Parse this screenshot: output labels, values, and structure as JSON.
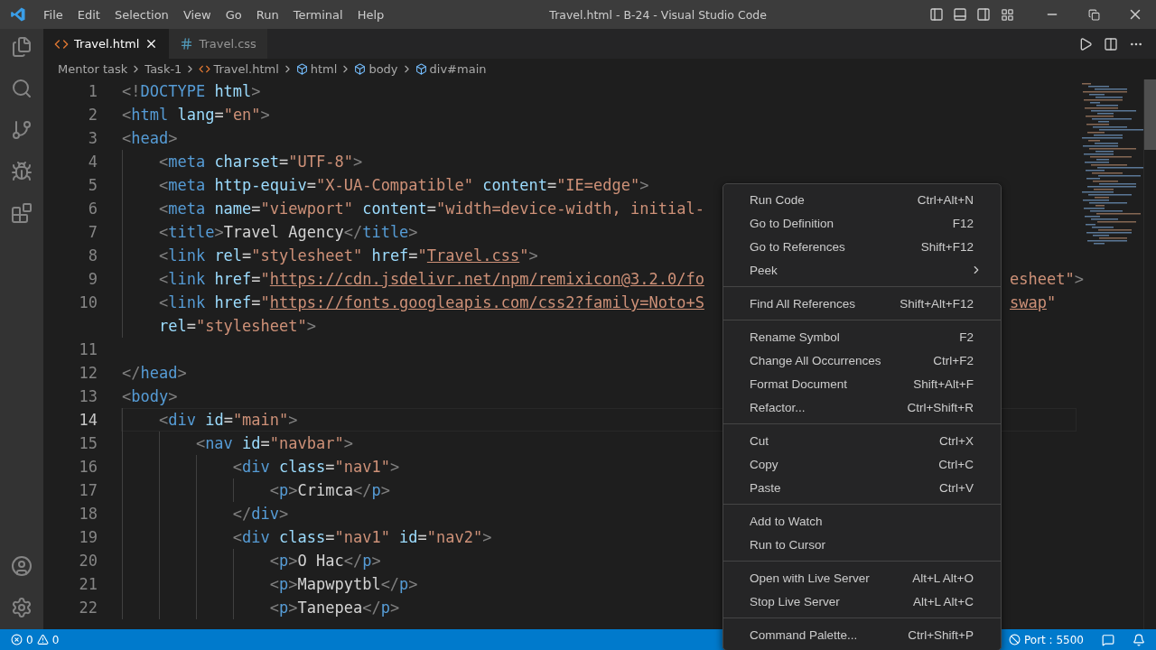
{
  "window": {
    "title": "Travel.html - B-24 - Visual Studio Code"
  },
  "menu_bar": [
    "File",
    "Edit",
    "Selection",
    "View",
    "Go",
    "Run",
    "Terminal",
    "Help"
  ],
  "tabs": [
    {
      "label": "Travel.html",
      "kind": "html",
      "selected": true
    },
    {
      "label": "Travel.css",
      "kind": "css",
      "selected": false
    }
  ],
  "breadcrumbs": [
    {
      "label": "Mentor task",
      "kind": "folder"
    },
    {
      "label": "Task-1",
      "kind": "folder"
    },
    {
      "label": "Travel.html",
      "kind": "file"
    },
    {
      "label": "html",
      "kind": "symbol"
    },
    {
      "label": "body",
      "kind": "symbol"
    },
    {
      "label": "div#main",
      "kind": "symbol"
    }
  ],
  "code_lines": [
    {
      "number": "1",
      "active": false,
      "tokens": [
        {
          "kind": "p",
          "text": "<!"
        },
        {
          "kind": "tag",
          "text": "DOCTYPE"
        },
        {
          "kind": "attr",
          "text": " html"
        },
        {
          "kind": "p",
          "text": ">"
        }
      ]
    },
    {
      "number": "2",
      "active": false,
      "tokens": [
        {
          "kind": "p",
          "text": "<"
        },
        {
          "kind": "tag",
          "text": "html"
        },
        {
          "kind": "attr",
          "text": " lang"
        },
        {
          "kind": "eq",
          "text": "="
        },
        {
          "kind": "str",
          "text": "\"en\""
        },
        {
          "kind": "p",
          "text": ">"
        }
      ]
    },
    {
      "number": "3",
      "active": false,
      "tokens": [
        {
          "kind": "p",
          "text": "<"
        },
        {
          "kind": "tag",
          "text": "head"
        },
        {
          "kind": "p",
          "text": ">"
        }
      ]
    },
    {
      "number": "4",
      "active": false,
      "tokens": [
        {
          "kind": "p",
          "text": "    <"
        },
        {
          "kind": "tag",
          "text": "meta"
        },
        {
          "kind": "attr",
          "text": " charset"
        },
        {
          "kind": "eq",
          "text": "="
        },
        {
          "kind": "str",
          "text": "\"UTF-8\""
        },
        {
          "kind": "p",
          "text": ">"
        }
      ]
    },
    {
      "number": "5",
      "active": false,
      "tokens": [
        {
          "kind": "p",
          "text": "    <"
        },
        {
          "kind": "tag",
          "text": "meta"
        },
        {
          "kind": "attr",
          "text": " http-equiv"
        },
        {
          "kind": "eq",
          "text": "="
        },
        {
          "kind": "str",
          "text": "\"X-UA-Compatible\""
        },
        {
          "kind": "attr",
          "text": " content"
        },
        {
          "kind": "eq",
          "text": "="
        },
        {
          "kind": "str",
          "text": "\"IE=edge\""
        },
        {
          "kind": "p",
          "text": ">"
        }
      ]
    },
    {
      "number": "6",
      "active": false,
      "tokens": [
        {
          "kind": "p",
          "text": "    <"
        },
        {
          "kind": "tag",
          "text": "meta"
        },
        {
          "kind": "attr",
          "text": " name"
        },
        {
          "kind": "eq",
          "text": "="
        },
        {
          "kind": "str",
          "text": "\"viewport\""
        },
        {
          "kind": "attr",
          "text": " content"
        },
        {
          "kind": "eq",
          "text": "="
        },
        {
          "kind": "str",
          "text": "\"width=device-width, initial-"
        }
      ]
    },
    {
      "number": "7",
      "active": false,
      "tokens": [
        {
          "kind": "p",
          "text": "    <"
        },
        {
          "kind": "tag",
          "text": "title"
        },
        {
          "kind": "p",
          "text": ">"
        },
        {
          "kind": "text",
          "text": "Travel Agency"
        },
        {
          "kind": "p",
          "text": "</"
        },
        {
          "kind": "tag",
          "text": "title"
        },
        {
          "kind": "p",
          "text": ">"
        }
      ]
    },
    {
      "number": "8",
      "active": false,
      "tokens": [
        {
          "kind": "p",
          "text": "    <"
        },
        {
          "kind": "tag",
          "text": "link"
        },
        {
          "kind": "attr",
          "text": " rel"
        },
        {
          "kind": "eq",
          "text": "="
        },
        {
          "kind": "str",
          "text": "\"stylesheet\""
        },
        {
          "kind": "attr",
          "text": " href"
        },
        {
          "kind": "eq",
          "text": "="
        },
        {
          "kind": "str",
          "text": "\""
        },
        {
          "kind": "link",
          "text": "Travel.css"
        },
        {
          "kind": "str",
          "text": "\""
        },
        {
          "kind": "p",
          "text": ">"
        }
      ]
    },
    {
      "number": "9",
      "active": false,
      "tokens": [
        {
          "kind": "p",
          "text": "    <"
        },
        {
          "kind": "tag",
          "text": "link"
        },
        {
          "kind": "attr",
          "text": " href"
        },
        {
          "kind": "eq",
          "text": "="
        },
        {
          "kind": "str",
          "text": "\""
        },
        {
          "kind": "link",
          "text": "https://cdn.jsdelivr.net/npm/remixicon@3.2.0/fo"
        }
      ],
      "tail": [
        {
          "kind": "str",
          "text": "esheet\""
        },
        {
          "kind": "p",
          "text": ">"
        }
      ]
    },
    {
      "number": "10",
      "active": false,
      "tokens": [
        {
          "kind": "p",
          "text": "    <"
        },
        {
          "kind": "tag",
          "text": "link"
        },
        {
          "kind": "attr",
          "text": " href"
        },
        {
          "kind": "eq",
          "text": "="
        },
        {
          "kind": "str",
          "text": "\""
        },
        {
          "kind": "link",
          "text": "https://fonts.googleapis.com/css2?family=Noto+S"
        }
      ],
      "tail": [
        {
          "kind": "link",
          "text": "swap"
        },
        {
          "kind": "str",
          "text": "\""
        }
      ],
      "wrap": [
        {
          "kind": "attr",
          "text": "    rel"
        },
        {
          "kind": "eq",
          "text": "="
        },
        {
          "kind": "str",
          "text": "\"stylesheet\""
        },
        {
          "kind": "p",
          "text": ">"
        }
      ]
    },
    {
      "number": "11",
      "active": false
    },
    {
      "number": "12",
      "active": false,
      "tokens": [
        {
          "kind": "p",
          "text": "</"
        },
        {
          "kind": "tag",
          "text": "head"
        },
        {
          "kind": "p",
          "text": ">"
        }
      ]
    },
    {
      "number": "13",
      "active": false,
      "tokens": [
        {
          "kind": "p",
          "text": "<"
        },
        {
          "kind": "tag",
          "text": "body"
        },
        {
          "kind": "p",
          "text": ">"
        }
      ]
    },
    {
      "number": "14",
      "active": true,
      "tokens": [
        {
          "kind": "p",
          "text": "    <"
        },
        {
          "kind": "tag",
          "text": "div"
        },
        {
          "kind": "attr",
          "text": " id"
        },
        {
          "kind": "eq",
          "text": "="
        },
        {
          "kind": "str",
          "text": "\"main\""
        },
        {
          "kind": "p",
          "text": ">"
        }
      ]
    },
    {
      "number": "15",
      "active": false,
      "tokens": [
        {
          "kind": "p",
          "text": "        <"
        },
        {
          "kind": "tag",
          "text": "nav"
        },
        {
          "kind": "attr",
          "text": " id"
        },
        {
          "kind": "eq",
          "text": "="
        },
        {
          "kind": "str",
          "text": "\"navbar\""
        },
        {
          "kind": "p",
          "text": ">"
        }
      ]
    },
    {
      "number": "16",
      "active": false,
      "tokens": [
        {
          "kind": "p",
          "text": "            <"
        },
        {
          "kind": "tag",
          "text": "div"
        },
        {
          "kind": "attr",
          "text": " class"
        },
        {
          "kind": "eq",
          "text": "="
        },
        {
          "kind": "str",
          "text": "\"nav1\""
        },
        {
          "kind": "p",
          "text": ">"
        }
      ]
    },
    {
      "number": "17",
      "active": false,
      "tokens": [
        {
          "kind": "p",
          "text": "                <"
        },
        {
          "kind": "tag",
          "text": "p"
        },
        {
          "kind": "p",
          "text": ">"
        },
        {
          "kind": "text",
          "text": "Crimca"
        },
        {
          "kind": "p",
          "text": "</"
        },
        {
          "kind": "tag",
          "text": "p"
        },
        {
          "kind": "p",
          "text": ">"
        }
      ]
    },
    {
      "number": "18",
      "active": false,
      "tokens": [
        {
          "kind": "p",
          "text": "            </"
        },
        {
          "kind": "tag",
          "text": "div"
        },
        {
          "kind": "p",
          "text": ">"
        }
      ]
    },
    {
      "number": "19",
      "active": false,
      "tokens": [
        {
          "kind": "p",
          "text": "            <"
        },
        {
          "kind": "tag",
          "text": "div"
        },
        {
          "kind": "attr",
          "text": " class"
        },
        {
          "kind": "eq",
          "text": "="
        },
        {
          "kind": "str",
          "text": "\"nav1\""
        },
        {
          "kind": "attr",
          "text": " id"
        },
        {
          "kind": "eq",
          "text": "="
        },
        {
          "kind": "str",
          "text": "\"nav2\""
        },
        {
          "kind": "p",
          "text": ">"
        }
      ]
    },
    {
      "number": "20",
      "active": false,
      "tokens": [
        {
          "kind": "p",
          "text": "                <"
        },
        {
          "kind": "tag",
          "text": "p"
        },
        {
          "kind": "p",
          "text": ">"
        },
        {
          "kind": "text",
          "text": "O Hac"
        },
        {
          "kind": "p",
          "text": "</"
        },
        {
          "kind": "tag",
          "text": "p"
        },
        {
          "kind": "p",
          "text": ">"
        }
      ]
    },
    {
      "number": "21",
      "active": false,
      "tokens": [
        {
          "kind": "p",
          "text": "                <"
        },
        {
          "kind": "tag",
          "text": "p"
        },
        {
          "kind": "p",
          "text": ">"
        },
        {
          "kind": "text",
          "text": "Mapwpytbl"
        },
        {
          "kind": "p",
          "text": "</"
        },
        {
          "kind": "tag",
          "text": "p"
        },
        {
          "kind": "p",
          "text": ">"
        }
      ]
    },
    {
      "number": "22",
      "active": false,
      "tokens": [
        {
          "kind": "p",
          "text": "                <"
        },
        {
          "kind": "tag",
          "text": "p"
        },
        {
          "kind": "p",
          "text": ">"
        },
        {
          "kind": "text",
          "text": "Tanepea"
        },
        {
          "kind": "p",
          "text": "</"
        },
        {
          "kind": "tag",
          "text": "p"
        },
        {
          "kind": "p",
          "text": ">"
        }
      ]
    }
  ],
  "context_menu": [
    [
      {
        "label": "Run Code",
        "shortcut": "Ctrl+Alt+N"
      },
      {
        "label": "Go to Definition",
        "shortcut": "F12"
      },
      {
        "label": "Go to References",
        "shortcut": "Shift+F12"
      },
      {
        "label": "Peek",
        "submenu": true
      }
    ],
    [
      {
        "label": "Find All References",
        "shortcut": "Shift+Alt+F12"
      }
    ],
    [
      {
        "label": "Rename Symbol",
        "shortcut": "F2"
      },
      {
        "label": "Change All Occurrences",
        "shortcut": "Ctrl+F2"
      },
      {
        "label": "Format Document",
        "shortcut": "Shift+Alt+F"
      },
      {
        "label": "Refactor...",
        "shortcut": "Ctrl+Shift+R"
      }
    ],
    [
      {
        "label": "Cut",
        "shortcut": "Ctrl+X"
      },
      {
        "label": "Copy",
        "shortcut": "Ctrl+C"
      },
      {
        "label": "Paste",
        "shortcut": "Ctrl+V"
      }
    ],
    [
      {
        "label": "Add to Watch"
      },
      {
        "label": "Run to Cursor"
      }
    ],
    [
      {
        "label": "Open with Live Server",
        "shortcut": "Alt+L Alt+O"
      },
      {
        "label": "Stop Live Server",
        "shortcut": "Alt+L Alt+C"
      }
    ],
    [
      {
        "label": "Command Palette...",
        "shortcut": "Ctrl+Shift+P"
      }
    ]
  ],
  "status_bar": {
    "errors": "0",
    "warnings": "0",
    "port": "Port : 5500"
  }
}
